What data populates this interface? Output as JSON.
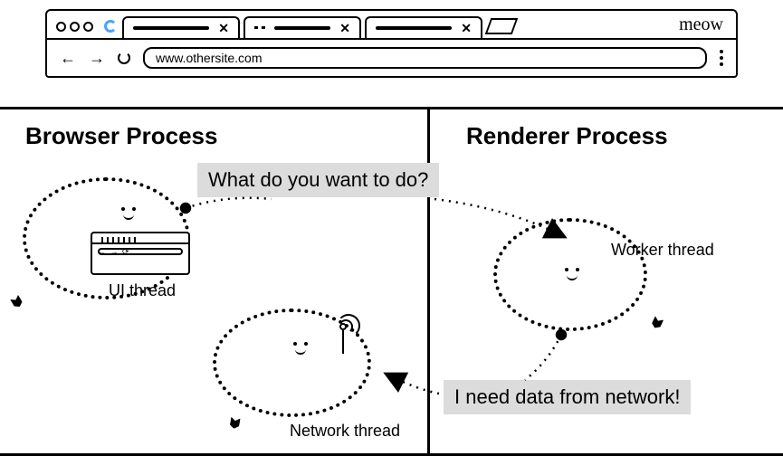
{
  "chrome": {
    "url": "www.othersite.com",
    "meow": "meow"
  },
  "processes": {
    "browser_title": "Browser Process",
    "renderer_title": "Renderer Process"
  },
  "threads": {
    "ui": "UI thread",
    "network": "Network thread",
    "worker": "Worker thread"
  },
  "bubbles": {
    "question": "What do you want to do?",
    "request": "I need data from network!"
  }
}
